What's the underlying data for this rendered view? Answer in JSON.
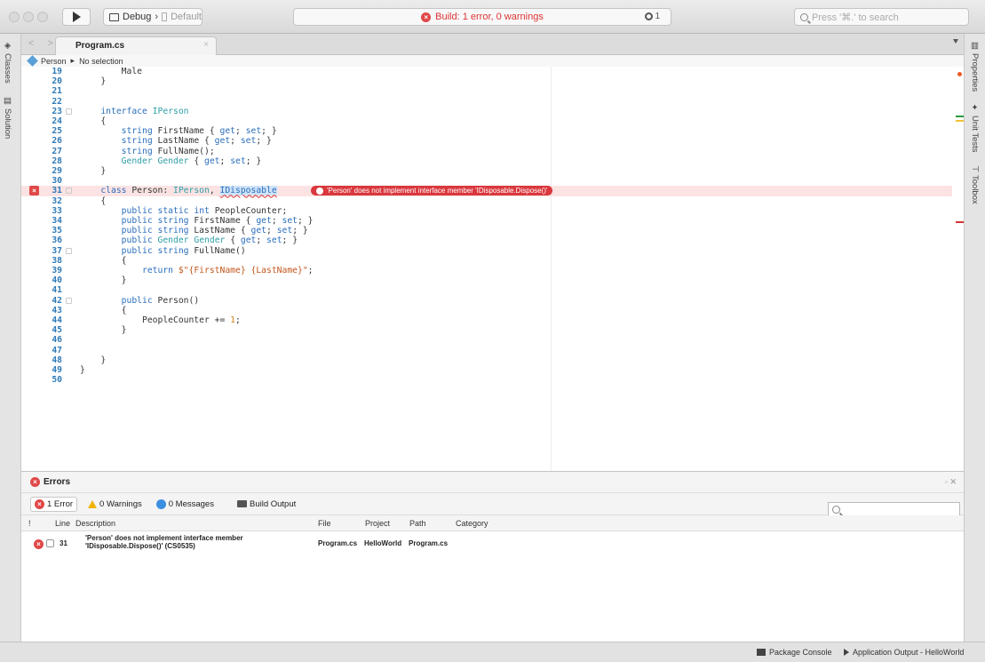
{
  "toolbar": {
    "config_label": "Debug",
    "config_separator": "›",
    "device_label": "Default",
    "build_status": "Build: 1 error, 0 warnings",
    "notification_count": "1",
    "search_placeholder": "Press '⌘.' to search"
  },
  "left_pads": [
    {
      "label": "Classes",
      "icon": "classes-icon"
    },
    {
      "label": "Solution",
      "icon": "solution-icon"
    }
  ],
  "right_pads": [
    {
      "label": "Properties",
      "icon": "properties-icon"
    },
    {
      "label": "Unit Tests",
      "icon": "unit-tests-icon"
    },
    {
      "label": "Toolbox",
      "icon": "toolbox-icon"
    }
  ],
  "editor": {
    "tab_label": "Program.cs",
    "nav_arrows": "<  >",
    "tab_close": "×",
    "breadcrumb_class": "Person",
    "breadcrumb_separator": "▸",
    "breadcrumb_member": "No selection",
    "lines": [
      {
        "n": "19",
        "text": "        Male"
      },
      {
        "n": "20",
        "text": "    }"
      },
      {
        "n": "21",
        "text": ""
      },
      {
        "n": "22",
        "text": ""
      },
      {
        "n": "23",
        "text": "    interface IPerson"
      },
      {
        "n": "24",
        "text": "    {"
      },
      {
        "n": "25",
        "text": "        string FirstName { get; set; }"
      },
      {
        "n": "26",
        "text": "        string LastName { get; set; }"
      },
      {
        "n": "27",
        "text": "        string FullName();"
      },
      {
        "n": "28",
        "text": "        Gender Gender { get; set; }"
      },
      {
        "n": "29",
        "text": "    }"
      },
      {
        "n": "30",
        "text": ""
      },
      {
        "n": "31",
        "text": "    class Person: IPerson, IDisposable"
      },
      {
        "n": "32",
        "text": "    {"
      },
      {
        "n": "33",
        "text": "        public static int PeopleCounter;"
      },
      {
        "n": "34",
        "text": "        public string FirstName { get; set; }"
      },
      {
        "n": "35",
        "text": "        public string LastName { get; set; }"
      },
      {
        "n": "36",
        "text": "        public Gender Gender { get; set; }"
      },
      {
        "n": "37",
        "text": "        public string FullName()"
      },
      {
        "n": "38",
        "text": "        {"
      },
      {
        "n": "39",
        "text": "            return $\"{FirstName} {LastName}\";"
      },
      {
        "n": "40",
        "text": "        }"
      },
      {
        "n": "41",
        "text": ""
      },
      {
        "n": "42",
        "text": "        public Person()"
      },
      {
        "n": "43",
        "text": "        {"
      },
      {
        "n": "44",
        "text": "            PeopleCounter += 1;"
      },
      {
        "n": "45",
        "text": "        }"
      },
      {
        "n": "46",
        "text": ""
      },
      {
        "n": "47",
        "text": ""
      },
      {
        "n": "48",
        "text": "    }"
      },
      {
        "n": "49",
        "text": "}"
      },
      {
        "n": "50",
        "text": ""
      }
    ],
    "error_line": "31",
    "error_message": "'Person' does not implement interface member 'IDisposable.Dispose()'"
  },
  "errors_pad": {
    "title": "Errors",
    "filters": {
      "errors": "1 Error",
      "warnings": "0 Warnings",
      "messages": "0 Messages",
      "build_output": "Build Output"
    },
    "columns": [
      "!",
      "Line",
      "Description",
      "File",
      "Project",
      "Path",
      "Category"
    ],
    "rows": [
      {
        "line": "31",
        "description_1": "'Person' does not implement interface member",
        "description_2": "'IDisposable.Dispose()' (CS0535)",
        "file": "Program.cs",
        "project": "HelloWorld",
        "path": "Program.cs",
        "category": ""
      }
    ]
  },
  "statusbar": {
    "package_console": "Package Console",
    "app_output": "Application Output - HelloWorld"
  },
  "colors": {
    "error_red": "#d9383d",
    "keyword_blue": "#2a6ebd",
    "type_teal": "#2f9ea8",
    "line_number": "#2e7ab8",
    "error_line_bg": "#fbe3e3"
  }
}
